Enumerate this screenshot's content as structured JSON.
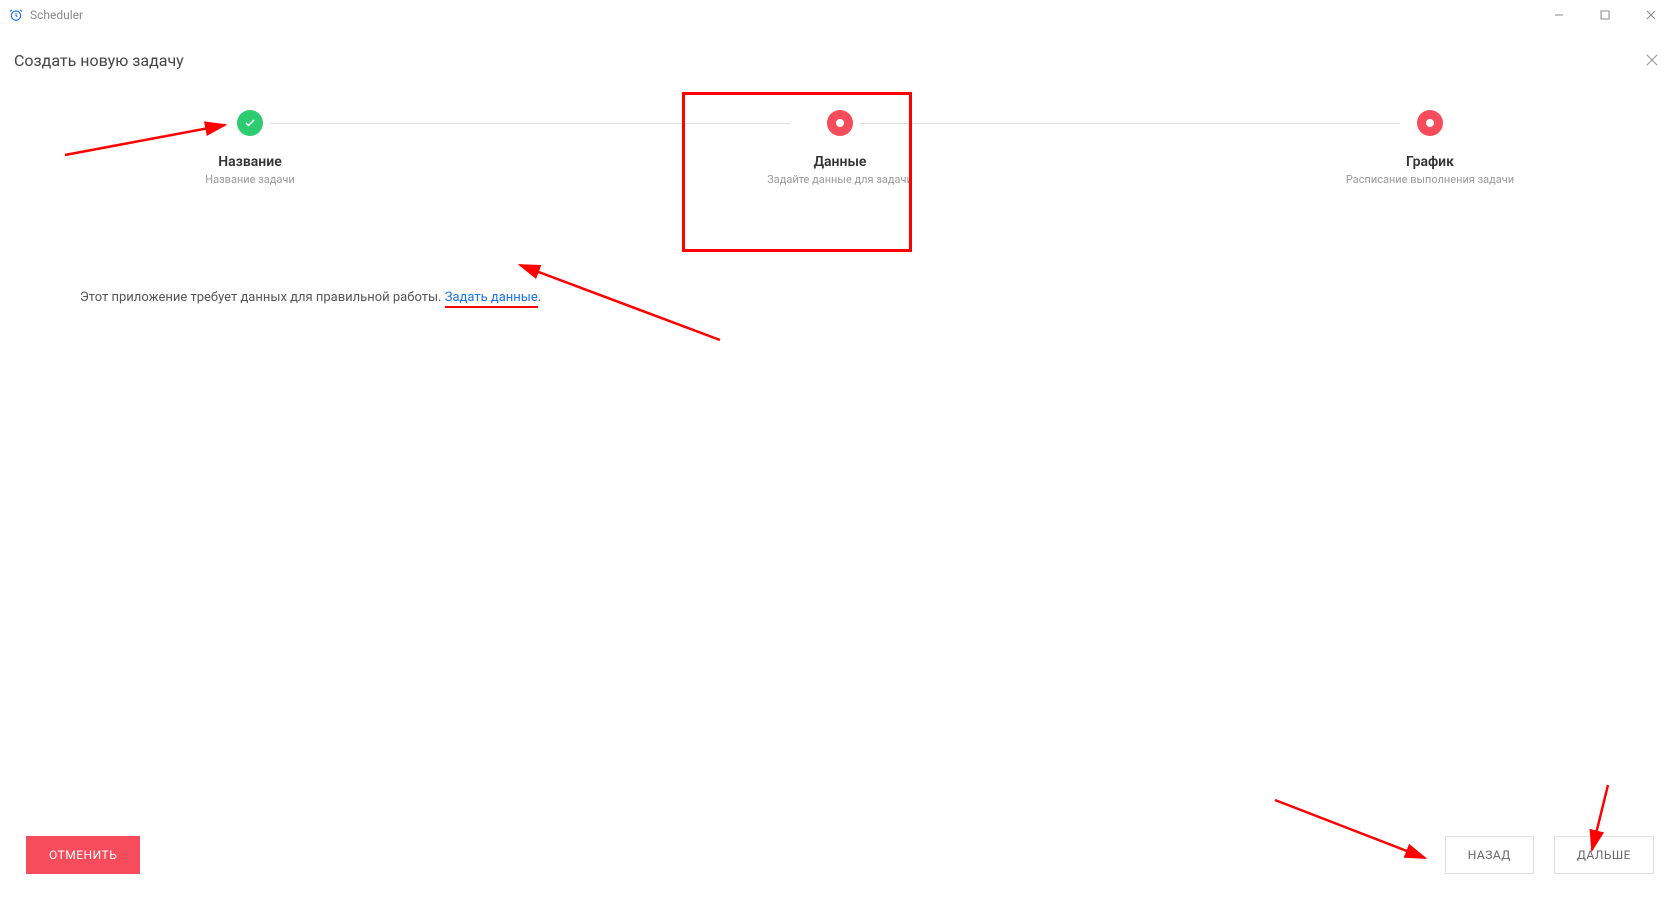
{
  "titlebar": {
    "app_name": "Scheduler"
  },
  "header": {
    "title": "Создать новую задачу"
  },
  "stepper": {
    "steps": [
      {
        "title": "Название",
        "subtitle": "Название задачи"
      },
      {
        "title": "Данные",
        "subtitle": "Задайте данные для задачи"
      },
      {
        "title": "График",
        "subtitle": "Расписание выполнения задачи"
      }
    ]
  },
  "body": {
    "text_prefix": "Этот приложение требует данных для правильной работы. ",
    "link_text": "Задать данные",
    "text_suffix": "."
  },
  "footer": {
    "cancel": "ОТМЕНИТЬ",
    "back": "НАЗАД",
    "next": "ДАЛЬШЕ"
  }
}
